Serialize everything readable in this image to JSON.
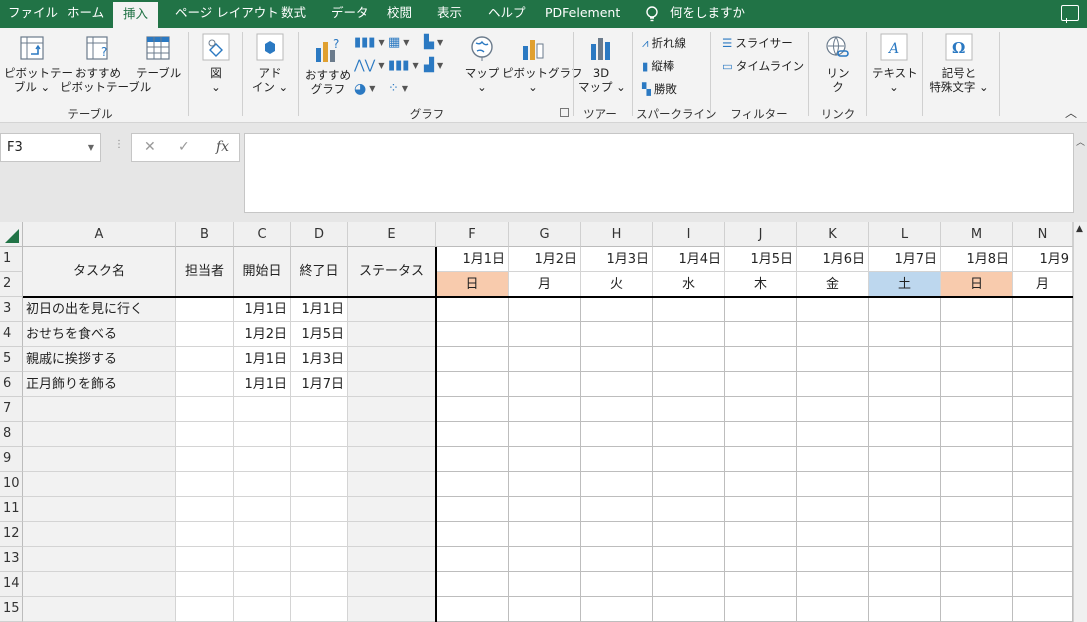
{
  "ribbon_tabs": [
    "ファイル",
    "ホーム",
    "挿入",
    "ページ レイアウト",
    "数式",
    "データ",
    "校閲",
    "表示",
    "ヘルプ",
    "PDFelement",
    "何をしますか"
  ],
  "active_tab": "挿入",
  "ribbon": {
    "groups": {
      "table": {
        "label": "テーブル",
        "pivot_table": "ピボットテー\nブル ⌄",
        "recommended_pivot": "おすすめ\nピボットテーブル",
        "table": "テーブル"
      },
      "illustrations": {
        "figure": "図\n⌄"
      },
      "addins": {
        "addins": "アド\nイン ⌄"
      },
      "charts": {
        "label": "グラフ",
        "recommended": "おすすめ\nグラフ",
        "map": "マップ\n⌄",
        "pivot_chart": "ピボットグラフ\n⌄"
      },
      "tours": {
        "label": "ツアー",
        "map3d": "3D\nマップ ⌄"
      },
      "sparklines": {
        "label": "スパークライン",
        "line": "折れ線",
        "column": "縦棒",
        "winloss": "勝敗"
      },
      "filters": {
        "label": "フィルター",
        "slicer": "スライサー",
        "timeline": "タイムライン"
      },
      "links": {
        "label": "リンク",
        "link": "リン\nク"
      },
      "text": {
        "text": "テキスト\n⌄"
      },
      "symbols": {
        "symbols": "記号と\n特殊文字 ⌄"
      }
    }
  },
  "formula_bar": {
    "name_box": "F3",
    "cancel": "✕",
    "enter": "✓",
    "fx": "fx",
    "formula": ""
  },
  "sheet": {
    "columns": [
      "A",
      "B",
      "C",
      "D",
      "E",
      "F",
      "G",
      "H",
      "I",
      "J",
      "K",
      "L",
      "M",
      "N"
    ],
    "rows": [
      "1",
      "2",
      "3",
      "4",
      "5",
      "6",
      "7",
      "8",
      "9",
      "10",
      "11",
      "12",
      "13",
      "14",
      "15"
    ],
    "headers": {
      "task": "タスク名",
      "assignee": "担当者",
      "start": "開始日",
      "end": "終了日",
      "status": "ステータス"
    },
    "dates": [
      "1月1日",
      "1月2日",
      "1月3日",
      "1月4日",
      "1月5日",
      "1月6日",
      "1月7日",
      "1月8日",
      "1月9"
    ],
    "weekdays": [
      "日",
      "月",
      "火",
      "水",
      "木",
      "金",
      "土",
      "日",
      "月"
    ],
    "weekday_colors": {
      "sunday": "#f8cbad",
      "saturday": "#bdd7ee"
    },
    "tasks": [
      {
        "name": "初日の出を見に行く",
        "assignee": "",
        "start": "1月1日",
        "end": "1月1日",
        "status": ""
      },
      {
        "name": "おせちを食べる",
        "assignee": "",
        "start": "1月2日",
        "end": "1月5日",
        "status": ""
      },
      {
        "name": "親戚に挨拶する",
        "assignee": "",
        "start": "1月1日",
        "end": "1月3日",
        "status": ""
      },
      {
        "name": "正月飾りを飾る",
        "assignee": "",
        "start": "1月1日",
        "end": "1月7日",
        "status": ""
      }
    ]
  },
  "colors": {
    "accent": "#217346",
    "ribbon_bg": "#f3f3f3"
  }
}
